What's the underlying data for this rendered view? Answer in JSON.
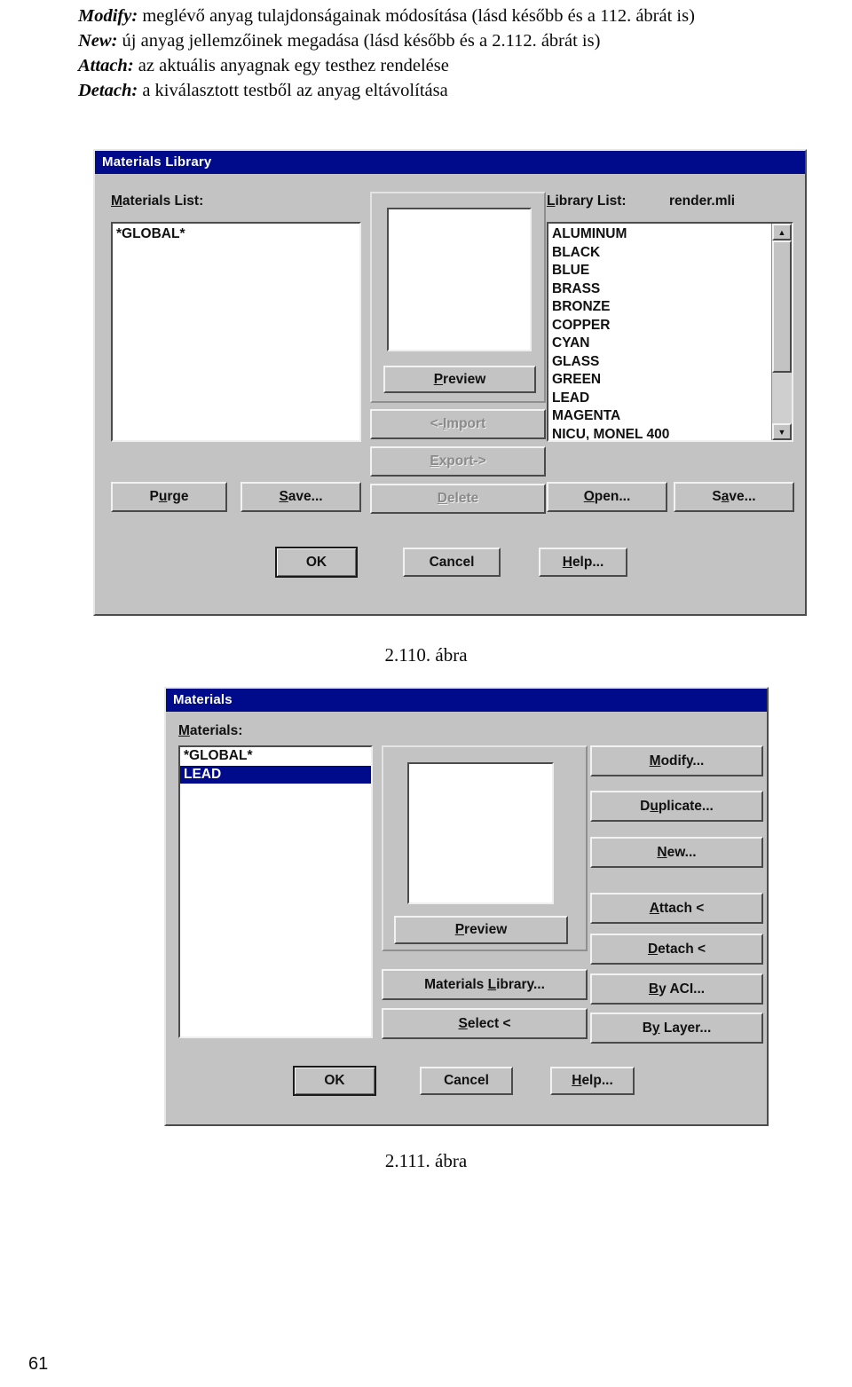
{
  "document": {
    "page_number": "61",
    "prose_lines": [
      {
        "keyword": "Modify:",
        "text": " meglévő anyag tulajdonságainak módosítása (lásd később és a 112. ábrát is)"
      },
      {
        "keyword": "New:",
        "text": " új anyag jellemzőinek megadása (lásd később és a 2.112. ábrát is)"
      },
      {
        "keyword": "Attach:",
        "text": " az aktuális anyagnak egy testhez rendelése"
      },
      {
        "keyword": "Detach:",
        "text": " a kiválasztott testből az anyag eltávolítása"
      }
    ],
    "captions": {
      "figure_1": "2.110. ábra",
      "figure_2": "2.111. ábra"
    }
  },
  "colors": {
    "titlebar": "#000b8c",
    "dialog_face": "#c3c3c3",
    "selection": "#000b8c",
    "text": "#111111",
    "disabled_text": "#8a8a8a"
  },
  "materials_library_dialog": {
    "title": "Materials Library",
    "materials_list": {
      "label": "Materials List:",
      "items": [
        "*GLOBAL*"
      ],
      "selected": null
    },
    "library_list": {
      "label": "Library List:",
      "file_name": "render.mli",
      "items": [
        "ALUMINUM",
        "BLACK",
        "BLUE",
        "BRASS",
        "BRONZE",
        "COPPER",
        "CYAN",
        "GLASS",
        "GREEN",
        "LEAD",
        "MAGENTA",
        "NICU, MONEL 400"
      ],
      "scrollbar": {
        "up_arrow": "scroll-up-icon",
        "down_arrow": "scroll-down-icon"
      }
    },
    "preview": {
      "button_label": "Preview",
      "button_accel": "P",
      "swatch_color": "#ffffff"
    },
    "transfer_buttons": [
      {
        "label": "<-Import",
        "accel": "I",
        "enabled": false
      },
      {
        "label": "Export->",
        "accel": "E",
        "enabled": false
      },
      {
        "label": "Delete",
        "accel": "D",
        "enabled": false
      }
    ],
    "left_buttons": [
      {
        "label": "Purge",
        "accel": "u",
        "enabled": true
      },
      {
        "label": "Save...",
        "accel": "S",
        "enabled": true
      }
    ],
    "right_buttons": [
      {
        "label": "Open...",
        "accel": "O",
        "enabled": true
      },
      {
        "label": "Save...",
        "accel": "a",
        "enabled": true
      }
    ],
    "footer_buttons": [
      {
        "label": "OK",
        "accel": "",
        "default": true
      },
      {
        "label": "Cancel",
        "accel": "",
        "default": false
      },
      {
        "label": "Help...",
        "accel": "H",
        "default": false
      }
    ]
  },
  "materials_dialog": {
    "title": "Materials",
    "materials_list": {
      "label": "Materials:",
      "items": [
        "*GLOBAL*",
        "LEAD"
      ],
      "selected": "LEAD"
    },
    "preview": {
      "button_label": "Preview",
      "button_accel": "P",
      "swatch_color": "#ffffff"
    },
    "middle_buttons": [
      {
        "label": "Materials Library...",
        "accel": "L"
      },
      {
        "label": "Select <",
        "accel": "S"
      }
    ],
    "action_buttons": [
      {
        "label": "Modify...",
        "accel": "M"
      },
      {
        "label": "Duplicate...",
        "accel": "u"
      },
      {
        "label": "New...",
        "accel": "N"
      },
      {
        "label": "Attach <",
        "accel": "A"
      },
      {
        "label": "Detach <",
        "accel": "D"
      },
      {
        "label": "By ACI...",
        "accel": "B"
      },
      {
        "label": "By Layer...",
        "accel": "y"
      }
    ],
    "footer_buttons": [
      {
        "label": "OK",
        "accel": "",
        "default": true
      },
      {
        "label": "Cancel",
        "accel": "",
        "default": false
      },
      {
        "label": "Help...",
        "accel": "H",
        "default": false
      }
    ]
  }
}
